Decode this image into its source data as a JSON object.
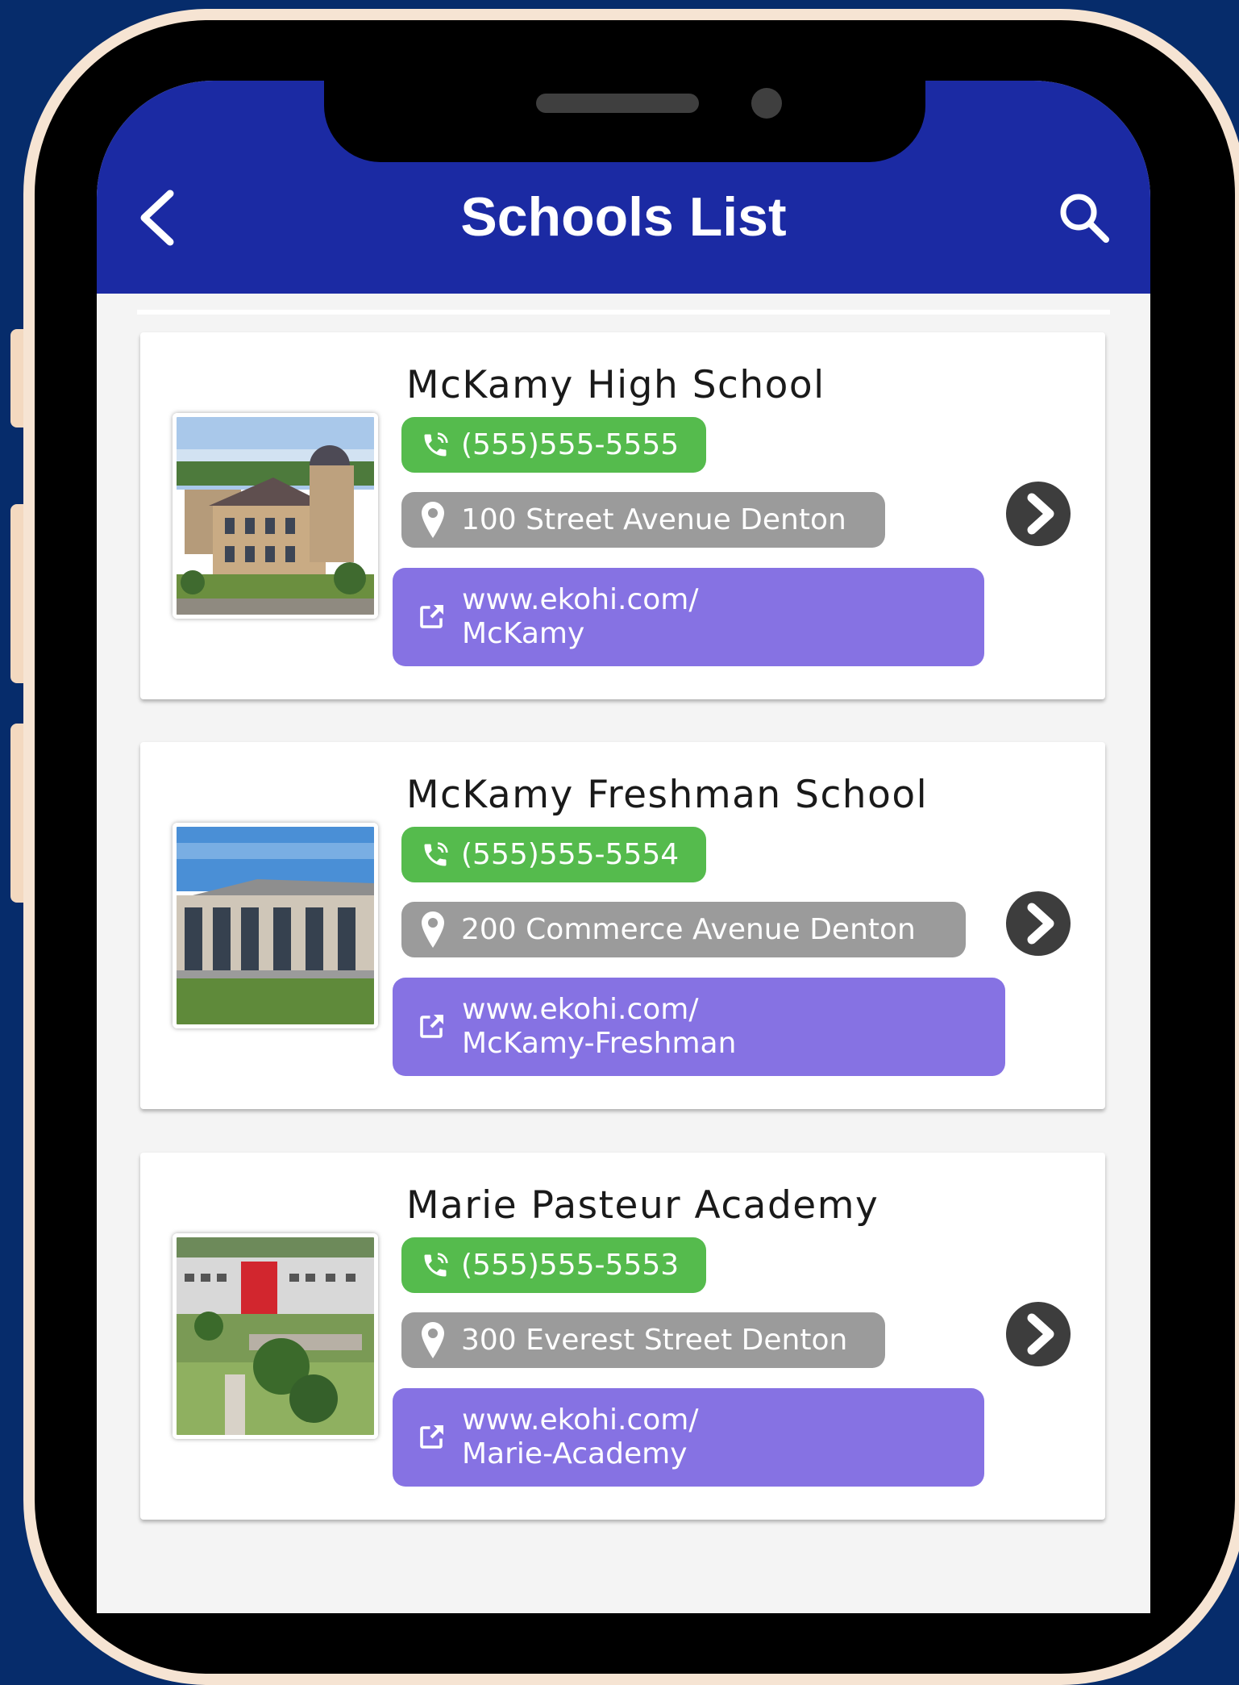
{
  "header": {
    "title": "Schools List",
    "back_icon": "chevron-left-icon",
    "search_icon": "search-icon"
  },
  "colors": {
    "header": "#1b2aa3",
    "phone": "#55bb4d",
    "address": "#9b9b9b",
    "url": "#8672e3",
    "chevron": "#3d3d3d"
  },
  "schools": [
    {
      "name": "McKamy High School",
      "phone": "(555)555-5555",
      "address": "100 Street Avenue Denton",
      "url": "www.ekohi.com/\nMcKamy"
    },
    {
      "name": "McKamy Freshman School",
      "phone": "(555)555-5554",
      "address": "200 Commerce Avenue Denton",
      "url": "www.ekohi.com/\nMcKamy-Freshman"
    },
    {
      "name": "Marie Pasteur Academy",
      "phone": "(555)555-5553",
      "address": "300 Everest Street Denton",
      "url": "www.ekohi.com/\nMarie-Academy"
    }
  ]
}
